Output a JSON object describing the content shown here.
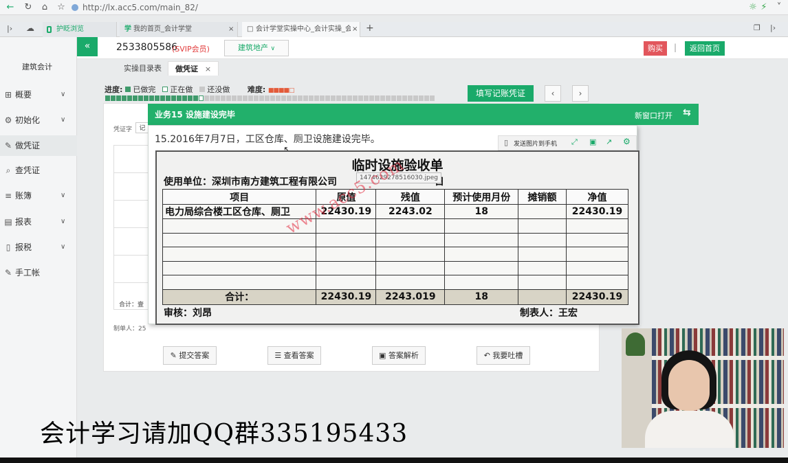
{
  "browser": {
    "url": "http://lx.acc5.com/main_82/",
    "tabs": [
      {
        "label": "护眨浏览"
      },
      {
        "label": "我的首页_会计学堂"
      },
      {
        "label": "会计学堂实操中心_会计实操_会"
      }
    ]
  },
  "header": {
    "collapse": "«",
    "user_id": "2533805586",
    "vip": "(SVIP会员)",
    "industry": "建筑地产",
    "buy": "购买",
    "home": "返回首页",
    "separator": "|"
  },
  "sidebar": {
    "title": "建筑会计",
    "items": [
      {
        "label": "概要",
        "icon": "grid-icon",
        "chevron": true
      },
      {
        "label": "初始化",
        "icon": "gear-icon",
        "chevron": true
      },
      {
        "label": "做凭证",
        "icon": "pen-icon",
        "chevron": false
      },
      {
        "label": "查凭证",
        "icon": "search-icon",
        "chevron": false
      },
      {
        "label": "账簿",
        "icon": "book-icon",
        "chevron": true
      },
      {
        "label": "报表",
        "icon": "table-icon",
        "chevron": true
      },
      {
        "label": "报税",
        "icon": "file-icon",
        "chevron": true
      },
      {
        "label": "手工帐",
        "icon": "pen-icon",
        "chevron": false
      }
    ]
  },
  "subtabs": [
    "实操目录表",
    "做凭证"
  ],
  "subtab_close": "×",
  "progress": {
    "label": "进度:",
    "done": "已做完",
    "doing": "正在做",
    "todo": "还没做",
    "difficulty_label": "难度:",
    "done_cells": 17,
    "total_cells": 60
  },
  "fill_btn": "填写记账凭证",
  "voucher": {
    "word_label": "凭证字",
    "word": "记",
    "total_label": "合计：壹",
    "maker_label": "制单人：25"
  },
  "actions": [
    {
      "label": "提交答案",
      "icon": "edit-icon"
    },
    {
      "label": "查看答案",
      "icon": "database-icon"
    },
    {
      "label": "答案解析",
      "icon": "folder-icon"
    },
    {
      "label": "我要吐槽",
      "icon": "reply-icon"
    }
  ],
  "modal": {
    "title": "业务15 设施建设完毕",
    "new_window": "新窗口打开",
    "description": "15.2016年7月7日，工区仓库、厕卫设施建设完毕。",
    "send_to_phone": "发送图片到手机",
    "tooltip": "1474629278516030.jpeg"
  },
  "document": {
    "title": "临时设施验收单",
    "unit": "使用单位：深圳市南方建筑工程有限公司",
    "unit_suffix": "日",
    "columns": [
      "项目",
      "原值",
      "残值",
      "预计使用月份",
      "摊销额",
      "净值"
    ],
    "rows": [
      [
        "电力局综合楼工区仓库、厕卫",
        "22430.19",
        "2243.02",
        "18",
        "",
        "22430.19"
      ]
    ],
    "blank_rows": 5,
    "total": [
      "合计：",
      "22430.19",
      "2243.019",
      "18",
      "",
      "22430.19"
    ],
    "reviewer": "审核：刘昂",
    "maker": "制表人：王宏",
    "watermark": "www.acc5.com"
  },
  "caption": "会计学习请加QQ群335195433",
  "colors": {
    "accent": "#1aaa6a",
    "buy": "#e2565c",
    "watermark": "#e0283c"
  }
}
